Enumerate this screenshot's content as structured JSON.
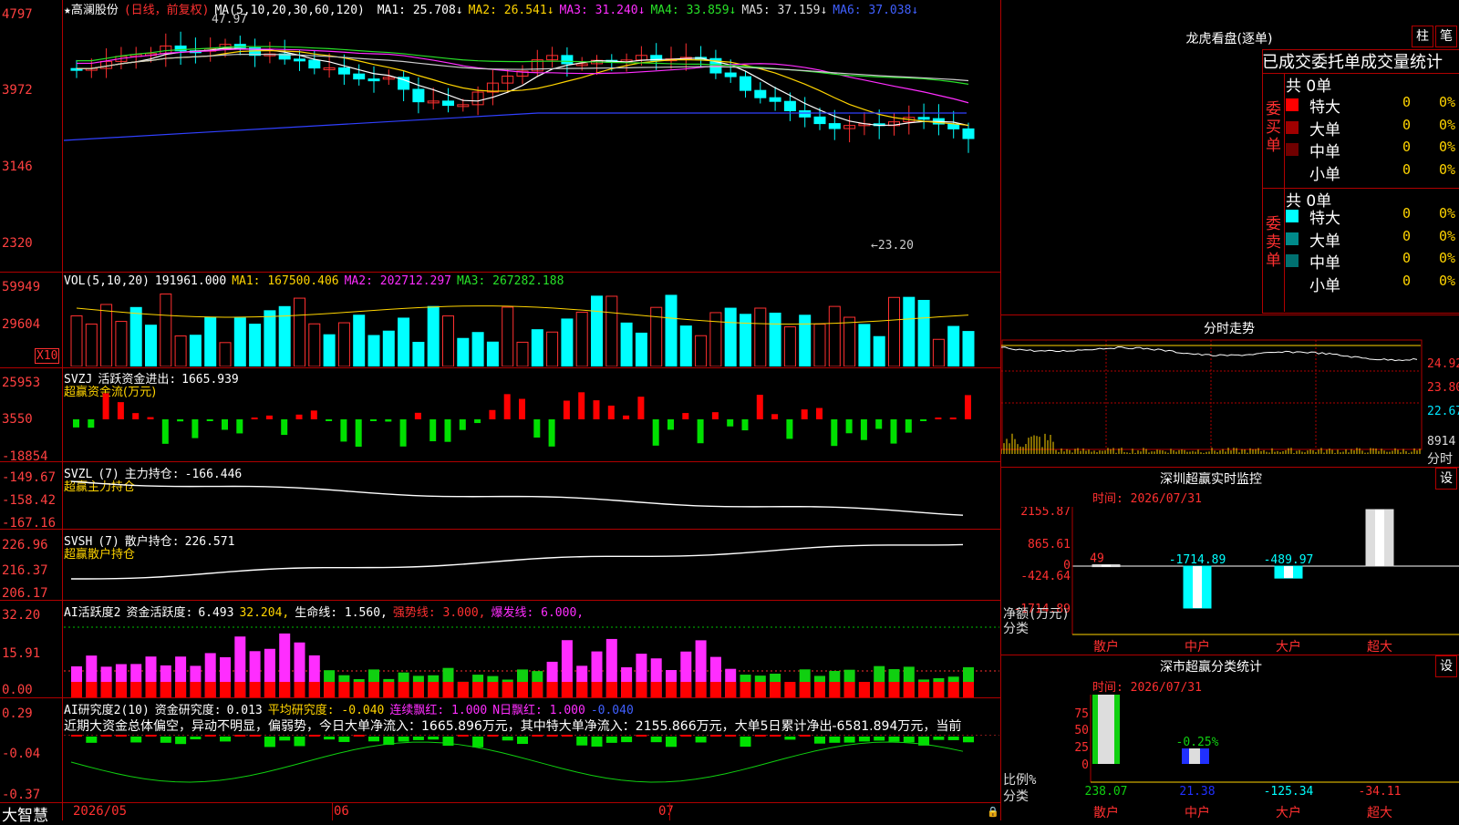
{
  "app": {
    "name": "大智慧"
  },
  "kline": {
    "stock_name": "★高澜股份",
    "period": "(日线，前复权)",
    "ma_label": "MA(5,10,20,30,60,120)",
    "ma_values": [
      {
        "name": "MA1:",
        "value": "25.708",
        "color": "#ffffff"
      },
      {
        "name": "MA2:",
        "value": "26.541",
        "color": "#ffd400"
      },
      {
        "name": "MA3:",
        "value": "31.240",
        "color": "#ff2dff"
      },
      {
        "name": "MA4:",
        "value": "33.859",
        "color": "#28e028"
      },
      {
        "name": "MA5:",
        "value": "37.159",
        "color": "#dddddd"
      },
      {
        "name": "MA6:",
        "value": "37.038",
        "color": "#4060ff"
      }
    ],
    "high_marker": "47.97",
    "low_marker": "←23.20",
    "y_ticks": [
      "4797",
      "3972",
      "3146",
      "2320"
    ]
  },
  "vol": {
    "label": "VOL(5,10,20)",
    "value": "191961.000",
    "ma1": "MA1: 167500.406",
    "ma2": "MA2: 202712.297",
    "ma3": "MA3: 267282.188",
    "y_ticks": [
      "59949",
      "29604"
    ],
    "unit": "X10"
  },
  "svzj": {
    "label": "SVZJ",
    "name": "活跃资金进出:",
    "value": "1665.939",
    "sub": "超赢资金流(万元)",
    "y_ticks": [
      "25953",
      "3550",
      "-18854"
    ]
  },
  "svzl": {
    "label": "SVZL",
    "param": "(7)",
    "name": "主力持仓:",
    "value": "-166.446",
    "sub": "超赢主力持仓",
    "y_ticks": [
      "-149.67",
      "-158.42",
      "-167.16"
    ]
  },
  "svsh": {
    "label": "SVSH",
    "param": "(7)",
    "name": "散户持仓:",
    "value": "226.571",
    "sub": "超赢散户持仓",
    "y_ticks": [
      "226.96",
      "216.37",
      "206.17"
    ]
  },
  "ai2": {
    "label": "AI活跃度2",
    "name": "资金活跃度:",
    "value": "6.493",
    "v2": "32.204,",
    "life": "生命线: 1.560,",
    "strong": "强势线: 3.000,",
    "burst": "爆发线: 6.000,",
    "y_ticks": [
      "32.20",
      "15.91",
      "0.00"
    ]
  },
  "ai_research": {
    "label": "AI研究度2(10)",
    "name": "资金研究度:",
    "value": "0.013",
    "avg": "平均研究度: -0.040",
    "cont": "连续飘红: 1.000",
    "nday": "N日飘红: 1.000",
    "last": "-0.040",
    "comment": "近期大资金总体偏空，异动不明显，偏弱势，今日大单净流入：1665.896万元，其中特大单净流入：2155.866万元，大单5日累计净出-6581.894万元，当前",
    "y_ticks": [
      "0.29",
      "-0.04",
      "-0.37"
    ]
  },
  "x_axis": {
    "labels": [
      "2026/05",
      "06",
      "07"
    ]
  },
  "right": {
    "dragon_title": "龙虎看盘(逐单)",
    "btn_bar": "柱",
    "btn_pen": "笔",
    "order_stats_title": "已成交委托单成交量统计",
    "buy": {
      "label": "委买单",
      "total": "共 0单",
      "rows": [
        {
          "name": "特大",
          "count": "0",
          "pct": "0%",
          "color": "#ff0000"
        },
        {
          "name": "大单",
          "count": "0",
          "pct": "0%",
          "color": "#a00000"
        },
        {
          "name": "中单",
          "count": "0",
          "pct": "0%",
          "color": "#700000"
        },
        {
          "name": "小单",
          "count": "0",
          "pct": "0%",
          "color": "#000000"
        }
      ]
    },
    "sell": {
      "label": "委卖单",
      "total": "共 0单",
      "rows": [
        {
          "name": "特大",
          "count": "0",
          "pct": "0%",
          "color": "#00ffff"
        },
        {
          "name": "大单",
          "count": "0",
          "pct": "0%",
          "color": "#008a8a"
        },
        {
          "name": "中单",
          "count": "0",
          "pct": "0%",
          "color": "#007070"
        },
        {
          "name": "小单",
          "count": "0",
          "pct": "0%",
          "color": "#000000"
        }
      ]
    },
    "intraday_title": "分时走势",
    "intraday_ticks": [
      "24.92",
      "23.80",
      "22.67",
      "8914"
    ],
    "intraday_unit": "分时",
    "sz_title": "深圳超赢实时监控",
    "sz_set": "设",
    "sz_time": "时间: 2026/07/31",
    "sz_y_ticks": [
      "2155.87",
      "865.61",
      "0",
      "-424.64",
      "-1714.89"
    ],
    "sz_ylabel": "净额(万元)",
    "sz_xlabel": "分类",
    "sz_categories": [
      "散户",
      "中户",
      "大户",
      "超大"
    ],
    "sz_values": [
      "49",
      "-1714.89",
      "-489.97",
      "2155.87"
    ],
    "cls_title": "深市超赢分类统计",
    "cls_set": "设",
    "cls_time": "时间: 2026/07/31",
    "cls_y_ticks": [
      "75",
      "50",
      "25",
      "0"
    ],
    "cls_ylabel": "比例%",
    "cls_xlabel": "分类",
    "cls_pct_label": "-0.25%",
    "cls_categories": [
      "散户",
      "中户",
      "大户",
      "超大"
    ],
    "cls_values": [
      "238.07",
      "21.38",
      "-125.34",
      "-34.11"
    ]
  },
  "chart_data": [
    {
      "type": "bar",
      "title": "深圳超赢实时监控",
      "ylabel": "净额(万元)",
      "categories": [
        "散户",
        "中户",
        "大户",
        "超大"
      ],
      "values": [
        49,
        -1714.89,
        -489.97,
        2155.87
      ],
      "ylim": [
        -1714.89,
        2155.87
      ]
    },
    {
      "type": "bar",
      "title": "深市超赢分类统计",
      "ylabel": "比例%",
      "categories": [
        "散户",
        "中户",
        "大户",
        "超大"
      ],
      "values": [
        238.07,
        21.38,
        -125.34,
        -34.11
      ],
      "ylim": [
        0,
        75
      ]
    }
  ]
}
